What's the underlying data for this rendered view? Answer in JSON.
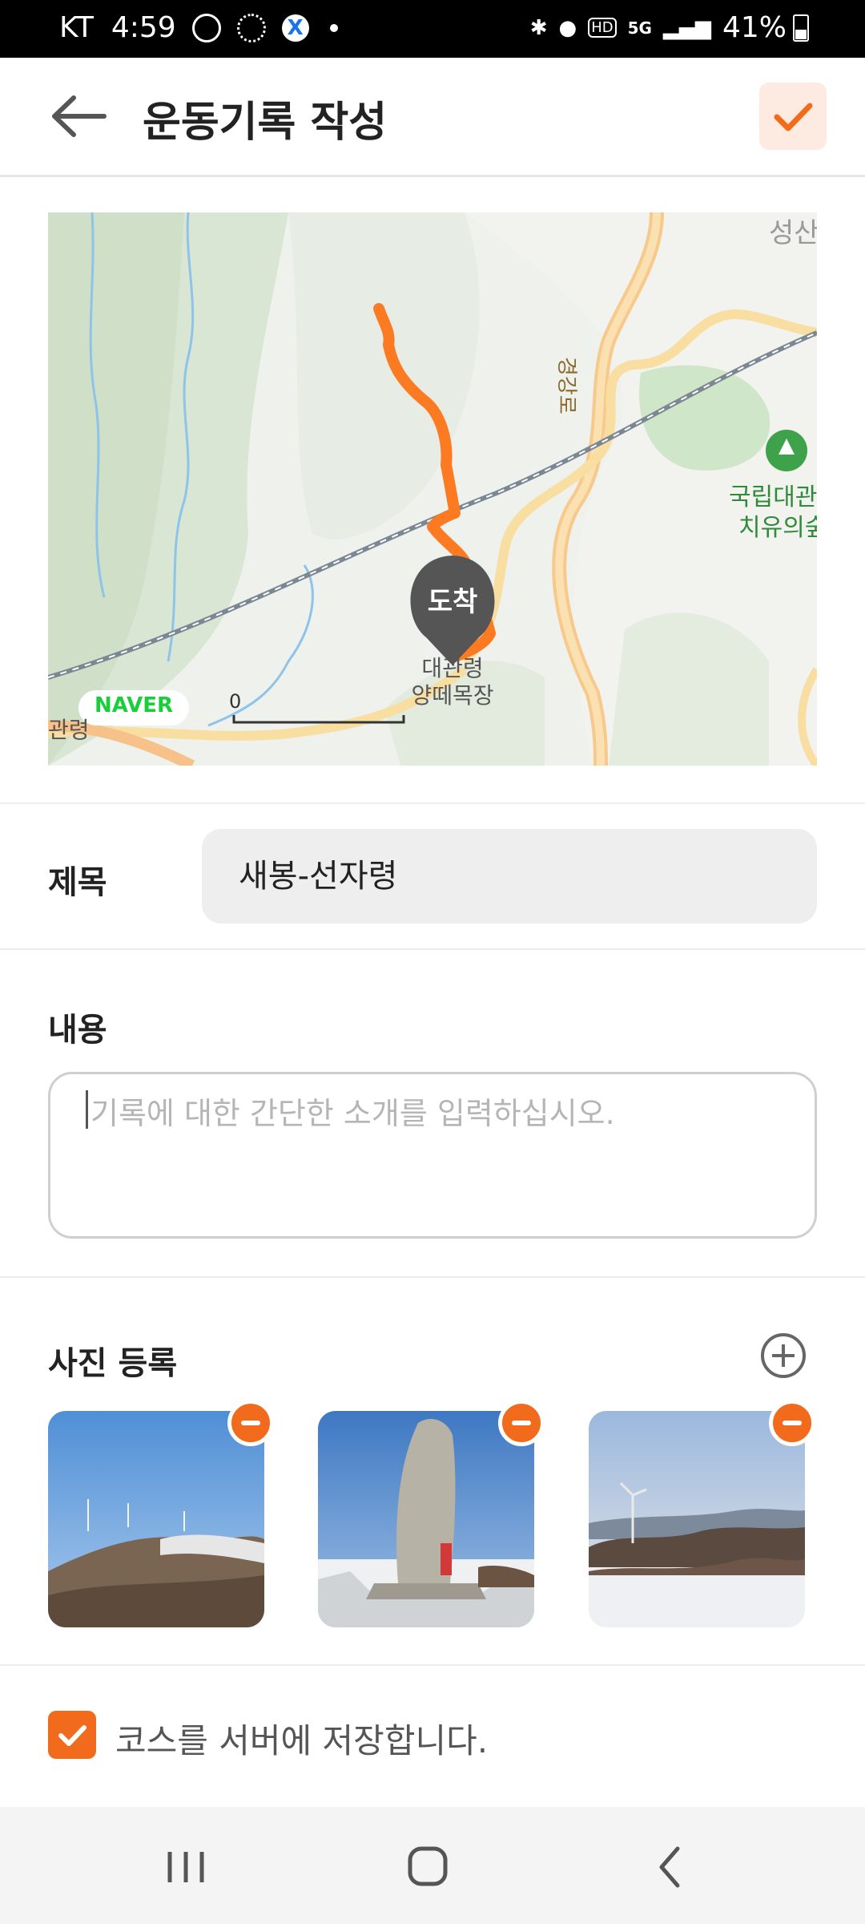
{
  "status_bar": {
    "carrier": "KT",
    "time": "4:59",
    "network": "5G",
    "hd_label": "HD",
    "battery": "41%"
  },
  "header": {
    "title": "운동기록 작성"
  },
  "map": {
    "end_marker_label": "도착",
    "place_label": "대관령\n양떼목장",
    "brand": "NAVER",
    "scale_start": "0",
    "top_right_label": "성산",
    "forest_label_1": "국립대관",
    "forest_label_2": "치유의숲",
    "road_label": "경강로",
    "left_label": "관령"
  },
  "form": {
    "title_label": "제목",
    "title_value": "새봉-선자령",
    "content_label": "내용",
    "content_placeholder": "기록에 대한 간단한 소개를 입력하십시오.",
    "photo_label": "사진 등록",
    "save_course_label": "코스를 서버에 저장합니다.",
    "save_course_checked": true
  },
  "colors": {
    "accent": "#f26a1b",
    "route": "#fb7a22",
    "marker": "#555555",
    "naver_green": "#19ce3b"
  }
}
